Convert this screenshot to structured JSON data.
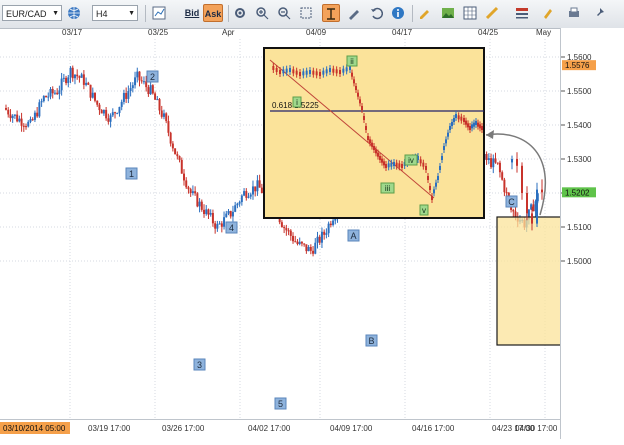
{
  "toolbar": {
    "symbol": "EUR/CAD",
    "timeframe": "H4",
    "bid_label": "Bid",
    "ask_label": "Ask"
  },
  "date_ticks": [
    "03/17",
    "03/25",
    "Apr",
    "04/09",
    "04/17",
    "04/25",
    "May"
  ],
  "chart_data": {
    "type": "candlestick",
    "price_ticks": [
      "1.5600",
      "1.5500",
      "1.5400",
      "1.5300",
      "1.5200",
      "1.5100",
      "1.5000"
    ],
    "current_price": "1.5576",
    "last_price": "1.5202",
    "time_ticks": [
      "03/19 17:00",
      "03/26 17:00",
      "04/02 17:00",
      "04/09 17:00",
      "04/16 17:00",
      "04/23 17:00",
      "04/30 17:00"
    ],
    "cursor_time": "03/10/2014 05:00",
    "ohlc_close_path": [
      1.545,
      1.542,
      1.54,
      1.548,
      1.55,
      1.556,
      1.553,
      1.546,
      1.542,
      1.548,
      1.554,
      1.55,
      1.542,
      1.53,
      1.52,
      1.515,
      1.51,
      1.514,
      1.52,
      1.522,
      1.518,
      1.51,
      1.505,
      1.503,
      1.508,
      1.516,
      1.52,
      1.525,
      1.518,
      1.515,
      1.52,
      1.524,
      1.526,
      1.528,
      1.525,
      1.527,
      1.53,
      1.528,
      1.515,
      1.511,
      1.519
    ],
    "wave_labels": [
      "1",
      "2",
      "3",
      "4",
      "5",
      "A",
      "B",
      "C"
    ],
    "inset_wave_labels": [
      "i",
      "ii",
      "iii",
      "iv",
      "v"
    ],
    "fib_label": "0.618 1.5225"
  }
}
